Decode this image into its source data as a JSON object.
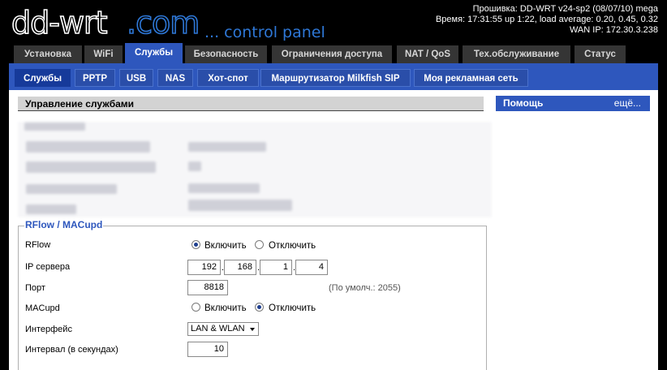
{
  "header": {
    "logo_text": "dd-wrt",
    "logo_suffix": ".com",
    "slogan": "... control panel",
    "firmware": "Прошивка: DD-WRT v24-sp2 (08/07/10) mega",
    "uptime": "Время: 17:31:55 up 1:22, load average: 0.20, 0.45, 0.32",
    "wan_ip": "WAN IP: 172.30.3.238"
  },
  "main_tabs": [
    {
      "label": "Установка"
    },
    {
      "label": "WiFi"
    },
    {
      "label": "Службы",
      "active": true
    },
    {
      "label": "Безопасность"
    },
    {
      "label": "Ограничения доступа"
    },
    {
      "label": "NAT / QoS"
    },
    {
      "label": "Тех.обслуживание"
    },
    {
      "label": "Статус"
    }
  ],
  "sub_tabs": [
    {
      "label": "Службы",
      "active": true
    },
    {
      "label": "PPTP"
    },
    {
      "label": "USB"
    },
    {
      "label": "NAS"
    },
    {
      "label": "Хот-спот"
    },
    {
      "label": "Маршрутизатор Milkfish SIP"
    },
    {
      "label": "Моя рекламная сеть"
    }
  ],
  "main": {
    "section_title": "Управление службами"
  },
  "help": {
    "title": "Помощь",
    "more": "ещё..."
  },
  "rflow": {
    "legend": "RFlow / MACupd",
    "rflow_label": "RFlow",
    "enable_label": "Включить",
    "disable_label": "Отключить",
    "rflow_state": "enabled",
    "server_ip_label": "IP сервера",
    "server_ip": [
      "192",
      "168",
      "1",
      "4"
    ],
    "port_label": "Порт",
    "port": "8818",
    "port_hint": "(По умолч.: 2055)",
    "macupd_label": "MACupd",
    "macupd_state": "disabled",
    "interface_label": "Интерфейс",
    "interface_value": "LAN & WLAN",
    "interval_label": "Интервал (в секундах)",
    "interval": "10"
  },
  "colors": {
    "accent": "#2e57bd",
    "tab_dark": "#353535",
    "logo_blue": "#2e77d6"
  }
}
